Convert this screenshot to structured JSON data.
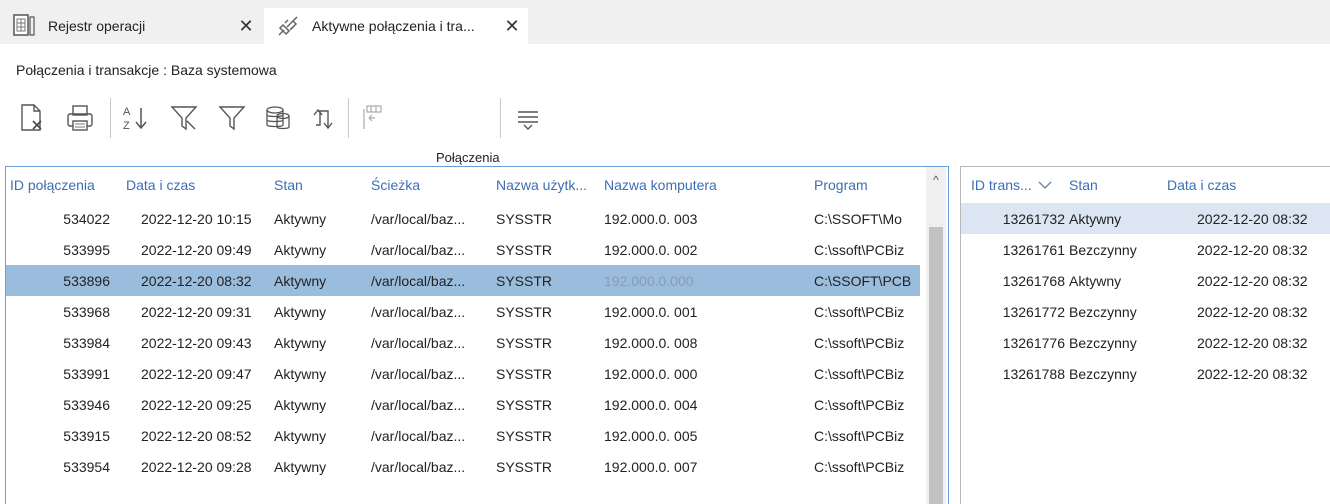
{
  "tabs": [
    {
      "label": "Rejestr operacji",
      "icon": "register-document-icon",
      "close": "✕"
    },
    {
      "label": "Aktywne połączenia i tra...",
      "icon": "plug-connection-icon",
      "close": "✕"
    }
  ],
  "subtitle": "Połączenia i transakcje : Baza systemowa",
  "toolbar": {
    "icons": [
      "clear-document-icon",
      "print-icon",
      "sort-az-icon",
      "filter-off-icon",
      "filter-icon",
      "database-icon",
      "refresh-icon",
      "columns-icon",
      "menu-lines-icon"
    ]
  },
  "connections": {
    "caption": "Połączenia",
    "headers": [
      "ID połączenia",
      "Data i czas",
      "Stan",
      "Ścieżka",
      "Nazwa użytk...",
      "Nazwa komputera",
      "Program"
    ],
    "rows": [
      [
        "534022",
        "2022-12-20 10:15",
        "Aktywny",
        "/var/local/baz...",
        "SYSSTR",
        "192.000.0. 003",
        "C:\\SSOFT\\Mo"
      ],
      [
        "533995",
        "2022-12-20 09:49",
        "Aktywny",
        "/var/local/baz...",
        "SYSSTR",
        "192.000.0. 002",
        "C:\\ssoft\\PCBiz"
      ],
      [
        "533896",
        "2022-12-20 08:32",
        "Aktywny",
        "/var/local/baz...",
        "SYSSTR",
        "192.000.0.000",
        "C:\\SSOFT\\PCB"
      ],
      [
        "533968",
        "2022-12-20 09:31",
        "Aktywny",
        "/var/local/baz...",
        "SYSSTR",
        "192.000.0. 001",
        "C:\\ssoft\\PCBiz"
      ],
      [
        "533984",
        "2022-12-20 09:43",
        "Aktywny",
        "/var/local/baz...",
        "SYSSTR",
        "192.000.0. 008",
        "C:\\ssoft\\PCBiz"
      ],
      [
        "533991",
        "2022-12-20 09:47",
        "Aktywny",
        "/var/local/baz...",
        "SYSSTR",
        "192.000.0. 000",
        "C:\\ssoft\\PCBiz"
      ],
      [
        "533946",
        "2022-12-20 09:25",
        "Aktywny",
        "/var/local/baz...",
        "SYSSTR",
        "192.000.0. 004",
        "C:\\ssoft\\PCBiz"
      ],
      [
        "533915",
        "2022-12-20 08:52",
        "Aktywny",
        "/var/local/baz...",
        "SYSSTR",
        "192.000.0. 005",
        "C:\\ssoft\\PCBiz"
      ],
      [
        "533954",
        "2022-12-20 09:28",
        "Aktywny",
        "/var/local/baz...",
        "SYSSTR",
        "192.000.0. 007",
        "C:\\ssoft\\PCBiz"
      ]
    ],
    "selected_index": 2
  },
  "transactions": {
    "headers": [
      "ID trans...",
      "Stan",
      "Data i czas"
    ],
    "rows": [
      [
        "13261732",
        "Aktywny",
        "2022-12-20 08:32"
      ],
      [
        "13261761",
        "Bezczynny",
        "2022-12-20 08:32"
      ],
      [
        "13261768",
        "Aktywny",
        "2022-12-20 08:32"
      ],
      [
        "13261772",
        "Bezczynny",
        "2022-12-20 08:32"
      ],
      [
        "13261776",
        "Bezczynny",
        "2022-12-20 08:32"
      ],
      [
        "13261788",
        "Bezczynny",
        "2022-12-20 08:32"
      ]
    ],
    "selected_index": 0
  },
  "colors": {
    "header_text": "#3b6fb6",
    "selected_row": "#9bbddd",
    "selected_row_light": "#dbe6f2"
  }
}
